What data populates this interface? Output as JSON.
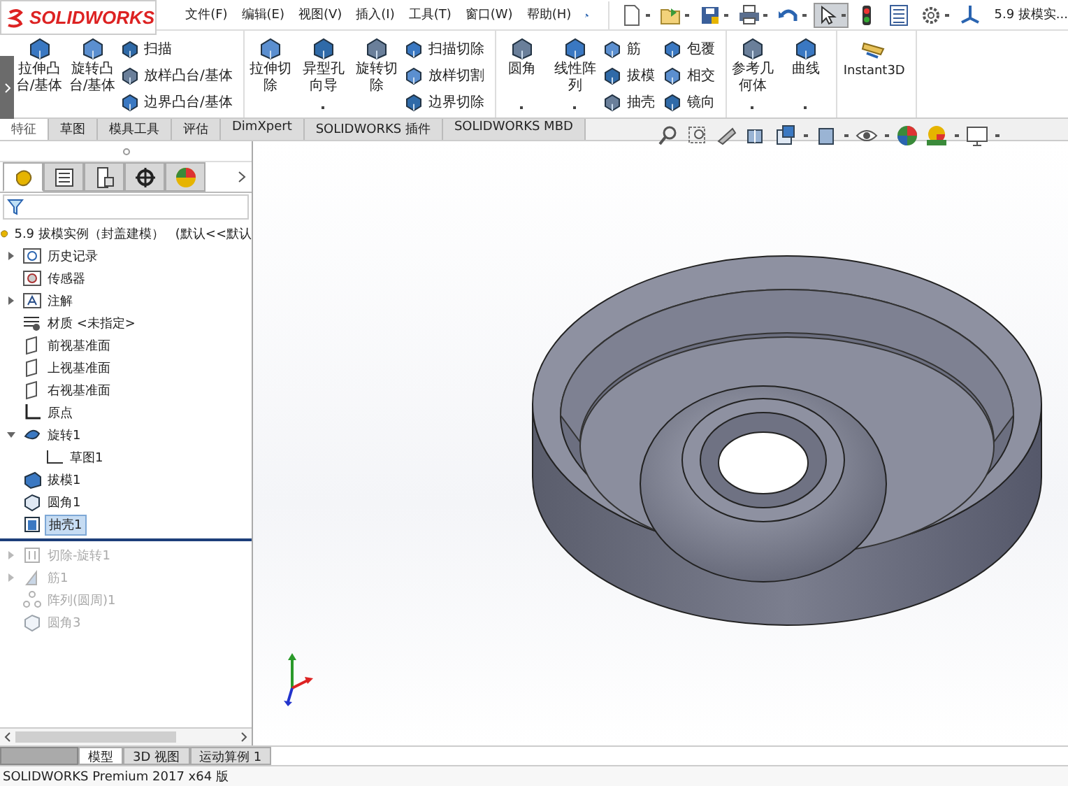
{
  "app": {
    "logo": "SOLIDWORKS"
  },
  "menu": [
    {
      "label": "文件(F)"
    },
    {
      "label": "编辑(E)"
    },
    {
      "label": "视图(V)"
    },
    {
      "label": "插入(I)"
    },
    {
      "label": "工具(T)"
    },
    {
      "label": "窗口(W)"
    },
    {
      "label": "帮助(H)"
    }
  ],
  "quick_toolbar": {
    "tools": [
      {
        "kind": "new",
        "dropdown": true,
        "selected": false
      },
      {
        "kind": "open",
        "dropdown": true,
        "selected": false
      },
      {
        "kind": "save",
        "dropdown": true,
        "selected": false
      },
      {
        "kind": "print",
        "dropdown": true,
        "selected": false
      },
      {
        "kind": "undo",
        "dropdown": true,
        "selected": false
      },
      {
        "kind": "select",
        "dropdown": true,
        "selected": true
      },
      {
        "kind": "rebuild",
        "dropdown": false,
        "selected": false
      },
      {
        "kind": "file-properties",
        "dropdown": false,
        "selected": false
      },
      {
        "kind": "options",
        "dropdown": true,
        "selected": false
      },
      {
        "kind": "view-origin",
        "dropdown": false,
        "selected": false
      }
    ],
    "document_title": "5.9 拔模实..."
  },
  "ribbon": {
    "groups": [
      {
        "items": [
          {
            "kind": "large",
            "label": "拉伸凸台/基体",
            "dropdown": false
          },
          {
            "kind": "large",
            "label": "旋转凸台/基体",
            "dropdown": false
          },
          {
            "kind": "stack",
            "items": [
              {
                "label": "扫描"
              },
              {
                "label": "放样凸台/基体"
              },
              {
                "label": "边界凸台/基体"
              }
            ]
          }
        ]
      },
      {
        "items": [
          {
            "kind": "large",
            "label": "拉伸切除",
            "dropdown": false
          },
          {
            "kind": "large",
            "label": "异型孔向导",
            "dropdown": true
          },
          {
            "kind": "large",
            "label": "旋转切除",
            "dropdown": false
          },
          {
            "kind": "stack",
            "items": [
              {
                "label": "扫描切除"
              },
              {
                "label": "放样切割"
              },
              {
                "label": "边界切除"
              }
            ]
          }
        ]
      },
      {
        "items": [
          {
            "kind": "large",
            "label": "圆角",
            "dropdown": true
          },
          {
            "kind": "large",
            "label": "线性阵列",
            "dropdown": true
          },
          {
            "kind": "stack",
            "items": [
              {
                "label": "筋"
              },
              {
                "label": "拔模"
              },
              {
                "label": "抽壳"
              }
            ]
          },
          {
            "kind": "stack",
            "items": [
              {
                "label": "包覆"
              },
              {
                "label": "相交"
              },
              {
                "label": "镜向"
              }
            ]
          }
        ]
      },
      {
        "items": [
          {
            "kind": "large",
            "label": "参考几何体",
            "dropdown": true
          },
          {
            "kind": "large",
            "label": "曲线",
            "dropdown": true
          }
        ]
      },
      {
        "items": [
          {
            "kind": "wide",
            "label": "Instant3D",
            "dropdown": false
          }
        ]
      }
    ]
  },
  "command_tabs": [
    {
      "label": "特征",
      "selected": true
    },
    {
      "label": "草图",
      "selected": false
    },
    {
      "label": "模具工具",
      "selected": false
    },
    {
      "label": "评估",
      "selected": false
    },
    {
      "label": "DimXpert",
      "selected": false
    },
    {
      "label": "SOLIDWORKS 插件",
      "selected": false
    },
    {
      "label": "SOLIDWORKS MBD",
      "selected": false
    }
  ],
  "feature_manager": {
    "tabs": [
      {
        "kind": "feature-tree",
        "selected": true
      },
      {
        "kind": "property",
        "selected": false
      },
      {
        "kind": "configuration",
        "selected": false
      },
      {
        "kind": "dimxpert",
        "selected": false
      },
      {
        "kind": "display",
        "selected": false
      }
    ],
    "root": {
      "name": "5.9 拔模实例（封盖建模）",
      "config": "(默认<<默认"
    },
    "tree": [
      {
        "kind": "history",
        "label": "历史记录",
        "expanded": false,
        "selected": false,
        "rolled_back": false
      },
      {
        "kind": "sensor",
        "label": "传感器",
        "selected": false,
        "rolled_back": false
      },
      {
        "kind": "annotation",
        "label": "注解",
        "expanded": false,
        "selected": false,
        "rolled_back": false
      },
      {
        "kind": "material",
        "label": "材质 <未指定>",
        "selected": false,
        "rolled_back": false
      },
      {
        "kind": "plane",
        "label": "前视基准面",
        "selected": false,
        "rolled_back": false
      },
      {
        "kind": "plane",
        "label": "上视基准面",
        "selected": false,
        "rolled_back": false
      },
      {
        "kind": "plane",
        "label": "右视基准面",
        "selected": false,
        "rolled_back": false
      },
      {
        "kind": "origin",
        "label": "原点",
        "selected": false,
        "rolled_back": false
      },
      {
        "kind": "revolve",
        "label": "旋转1",
        "expanded": true,
        "selected": false,
        "rolled_back": false,
        "children": [
          {
            "kind": "sketch",
            "label": "草图1",
            "selected": false,
            "rolled_back": false
          }
        ]
      },
      {
        "kind": "draft",
        "label": "拔模1",
        "selected": false,
        "rolled_back": false
      },
      {
        "kind": "fillet",
        "label": "圆角1",
        "selected": false,
        "rolled_back": false
      },
      {
        "kind": "shell",
        "label": "抽壳1",
        "selected": true,
        "rolled_back": false
      },
      {
        "kind": "rollback-bar"
      },
      {
        "kind": "cut-revolve",
        "label": "切除-旋转1",
        "expanded": false,
        "selected": false,
        "rolled_back": true
      },
      {
        "kind": "rib",
        "label": "筋1",
        "expanded": false,
        "selected": false,
        "rolled_back": true
      },
      {
        "kind": "pattern",
        "label": "阵列(圆周)1",
        "selected": false,
        "rolled_back": true
      },
      {
        "kind": "fillet",
        "label": "圆角3",
        "selected": false,
        "rolled_back": true
      }
    ]
  },
  "model_tabs": [
    {
      "label": "模型",
      "selected": true
    },
    {
      "label": "3D 视图",
      "selected": false
    },
    {
      "label": "运动算例 1",
      "selected": false
    }
  ],
  "status_bar": "SOLIDWORKS Premium 2017 x64 版"
}
